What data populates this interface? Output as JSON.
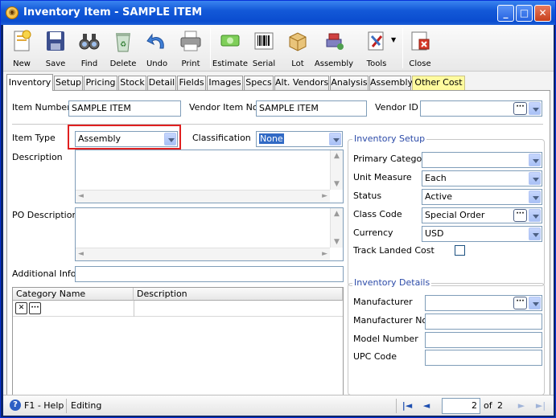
{
  "window": {
    "title": "Inventory Item - SAMPLE ITEM"
  },
  "toolbar": {
    "items": [
      {
        "label": "New",
        "icon": "new-doc-icon"
      },
      {
        "label": "Save",
        "icon": "floppy-save-icon"
      },
      {
        "label": "Find",
        "icon": "binoculars-icon"
      },
      {
        "label": "Delete",
        "icon": "recycle-bin-icon"
      },
      {
        "label": "Undo",
        "icon": "undo-arrow-icon"
      },
      {
        "label": "Print",
        "icon": "printer-icon"
      },
      {
        "label": "Estimate",
        "icon": "money-estimate-icon"
      },
      {
        "label": "Serial",
        "icon": "barcode-icon"
      },
      {
        "label": "Lot",
        "icon": "lot-boxes-icon"
      },
      {
        "label": "Assembly",
        "icon": "assembly-parts-icon"
      },
      {
        "label": "Tools",
        "icon": "tools-icon"
      },
      {
        "label": "Close",
        "icon": "close-doc-icon"
      }
    ]
  },
  "tabs": [
    "Inventory",
    "Setup",
    "Pricing",
    "Stock",
    "Detail",
    "Fields",
    "Images",
    "Specs",
    "Alt. Vendors",
    "Analysis",
    "Assembly",
    "Other Cost"
  ],
  "form": {
    "item_number_label": "Item Number",
    "item_number": "SAMPLE ITEM",
    "vendor_item_no_label": "Vendor Item No",
    "vendor_item_no": "SAMPLE ITEM",
    "vendor_id_label": "Vendor ID",
    "vendor_id": "",
    "item_type_label": "Item Type",
    "item_type": "Assembly",
    "classification_label": "Classification",
    "classification": "None",
    "description_label": "Description",
    "po_description_label": "PO Description",
    "additional_info_label": "Additional Info",
    "grid_headers": [
      "Category Name",
      "Description"
    ]
  },
  "inventory_setup": {
    "title": "Inventory Setup",
    "primary_category_label": "Primary Category",
    "primary_category": "",
    "unit_measure_label": "Unit Measure",
    "unit_measure": "Each",
    "status_label": "Status",
    "status": "Active",
    "class_code_label": "Class Code",
    "class_code": "Special Order",
    "currency_label": "Currency",
    "currency": "USD",
    "track_landed_cost_label": "Track Landed Cost"
  },
  "inventory_details": {
    "title": "Inventory Details",
    "manufacturer_label": "Manufacturer",
    "manufacturer_no_label": "Manufacturer No",
    "model_number_label": "Model Number",
    "upc_code_label": "UPC Code"
  },
  "status": {
    "help": "F1 - Help",
    "mode": "Editing",
    "page": "2",
    "of_label": "of",
    "total": "2"
  },
  "colors": {
    "highlight_tab": "#fffb9e",
    "title_blue": "#0a4ccf",
    "red_box": "#e02020"
  }
}
